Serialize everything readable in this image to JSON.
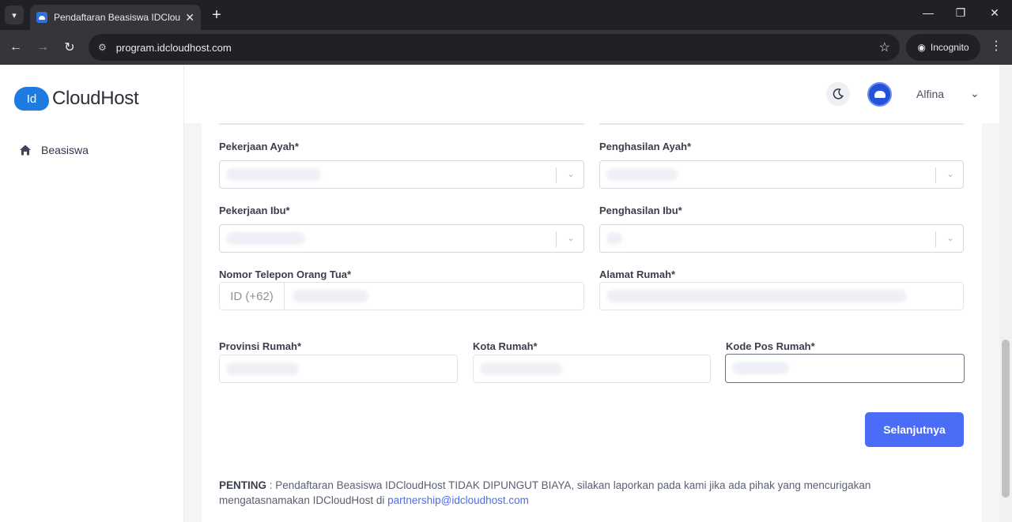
{
  "browser": {
    "tab_title": "Pendaftaran Beasiswa IDCloudh",
    "url": "program.idcloudhost.com",
    "incognito_label": "Incognito"
  },
  "app": {
    "logo_badge": "Id",
    "logo_text": "CloudHost",
    "sidebar": {
      "items": [
        {
          "label": "Beasiswa",
          "icon": "home-icon"
        }
      ]
    },
    "user": {
      "name": "Alfina"
    }
  },
  "form": {
    "father_job": {
      "label": "Pekerjaan Ayah*"
    },
    "father_income": {
      "label": "Penghasilan Ayah*"
    },
    "mother_job": {
      "label": "Pekerjaan Ibu*"
    },
    "mother_income": {
      "label": "Penghasilan Ibu*"
    },
    "parent_phone": {
      "label": "Nomor Telepon Orang Tua*",
      "prefix": "ID (+62)"
    },
    "home_address": {
      "label": "Alamat Rumah*"
    },
    "province": {
      "label": "Provinsi Rumah*"
    },
    "city": {
      "label": "Kota Rumah*"
    },
    "postal_code": {
      "label": "Kode Pos Rumah*"
    },
    "next_label": "Selanjutnya"
  },
  "notice": {
    "strong": "PENTING",
    "text": " : Pendaftaran Beasiswa IDCloudHost TIDAK DIPUNGUT BIAYA, silakan laporkan pada kami jika ada pihak yang mencurigakan mengatasnamakan IDCloudHost di ",
    "link": "partnership@idcloudhost.com"
  },
  "colors": {
    "primary": "#4a6cf7",
    "brand": "#1e7be0"
  }
}
